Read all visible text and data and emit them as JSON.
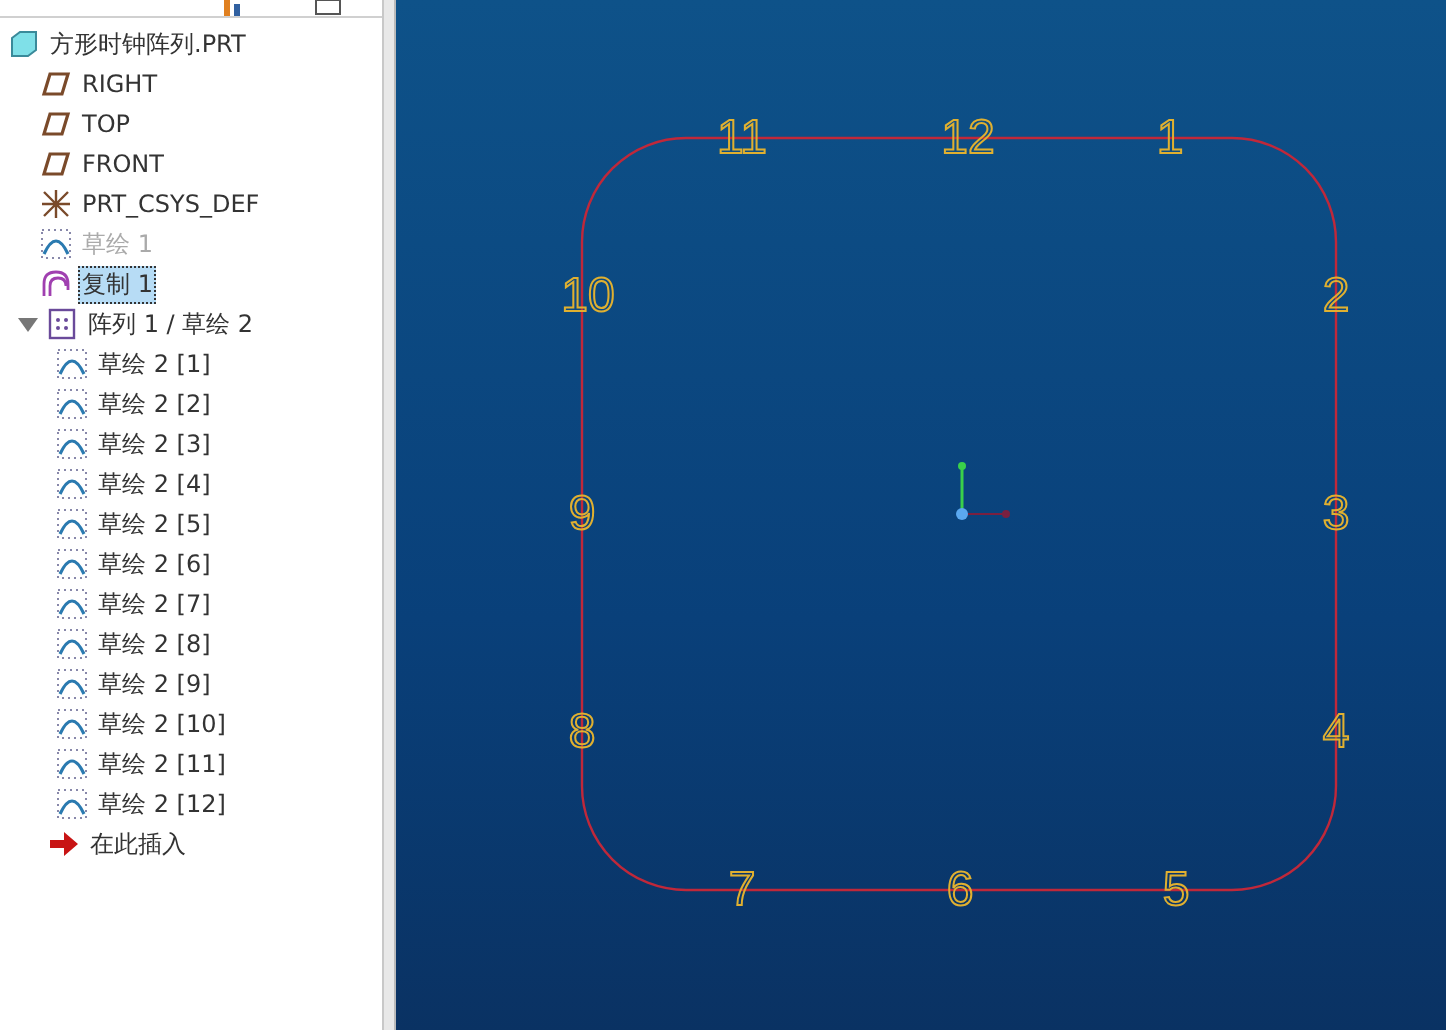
{
  "model_tree": {
    "root": {
      "label": "方形时钟阵列.PRT",
      "children": [
        {
          "kind": "plane",
          "label": "RIGHT",
          "selected": false,
          "disabled": false
        },
        {
          "kind": "plane",
          "label": "TOP",
          "selected": false,
          "disabled": false
        },
        {
          "kind": "plane",
          "label": "FRONT",
          "selected": false,
          "disabled": false
        },
        {
          "kind": "csys",
          "label": "PRT_CSYS_DEF",
          "selected": false,
          "disabled": false
        },
        {
          "kind": "sketch",
          "label": "草绘 1",
          "selected": false,
          "disabled": true
        },
        {
          "kind": "copy",
          "label": "复制 1",
          "selected": true,
          "disabled": false
        },
        {
          "kind": "pattern",
          "label": "阵列 1 / 草绘 2",
          "selected": false,
          "disabled": false,
          "expanded": true,
          "children": [
            {
              "kind": "sketch",
              "label": "草绘 2 [1]",
              "selected": false,
              "disabled": false
            },
            {
              "kind": "sketch",
              "label": "草绘 2 [2]",
              "selected": false,
              "disabled": false
            },
            {
              "kind": "sketch",
              "label": "草绘 2 [3]",
              "selected": false,
              "disabled": false
            },
            {
              "kind": "sketch",
              "label": "草绘 2 [4]",
              "selected": false,
              "disabled": false
            },
            {
              "kind": "sketch",
              "label": "草绘 2 [5]",
              "selected": false,
              "disabled": false
            },
            {
              "kind": "sketch",
              "label": "草绘 2 [6]",
              "selected": false,
              "disabled": false
            },
            {
              "kind": "sketch",
              "label": "草绘 2 [7]",
              "selected": false,
              "disabled": false
            },
            {
              "kind": "sketch",
              "label": "草绘 2 [8]",
              "selected": false,
              "disabled": false
            },
            {
              "kind": "sketch",
              "label": "草绘 2 [9]",
              "selected": false,
              "disabled": false
            },
            {
              "kind": "sketch",
              "label": "草绘 2 [10]",
              "selected": false,
              "disabled": false
            },
            {
              "kind": "sketch",
              "label": "草绘 2 [11]",
              "selected": false,
              "disabled": false
            },
            {
              "kind": "sketch",
              "label": "草绘 2 [12]",
              "selected": false,
              "disabled": false
            }
          ]
        },
        {
          "kind": "insert",
          "label": "在此插入",
          "selected": false,
          "disabled": false
        }
      ]
    }
  },
  "viewport": {
    "clock_numerals": [
      "11",
      "12",
      "1",
      "10",
      "2",
      "9",
      "3",
      "8",
      "4",
      "7",
      "6",
      "5"
    ]
  }
}
